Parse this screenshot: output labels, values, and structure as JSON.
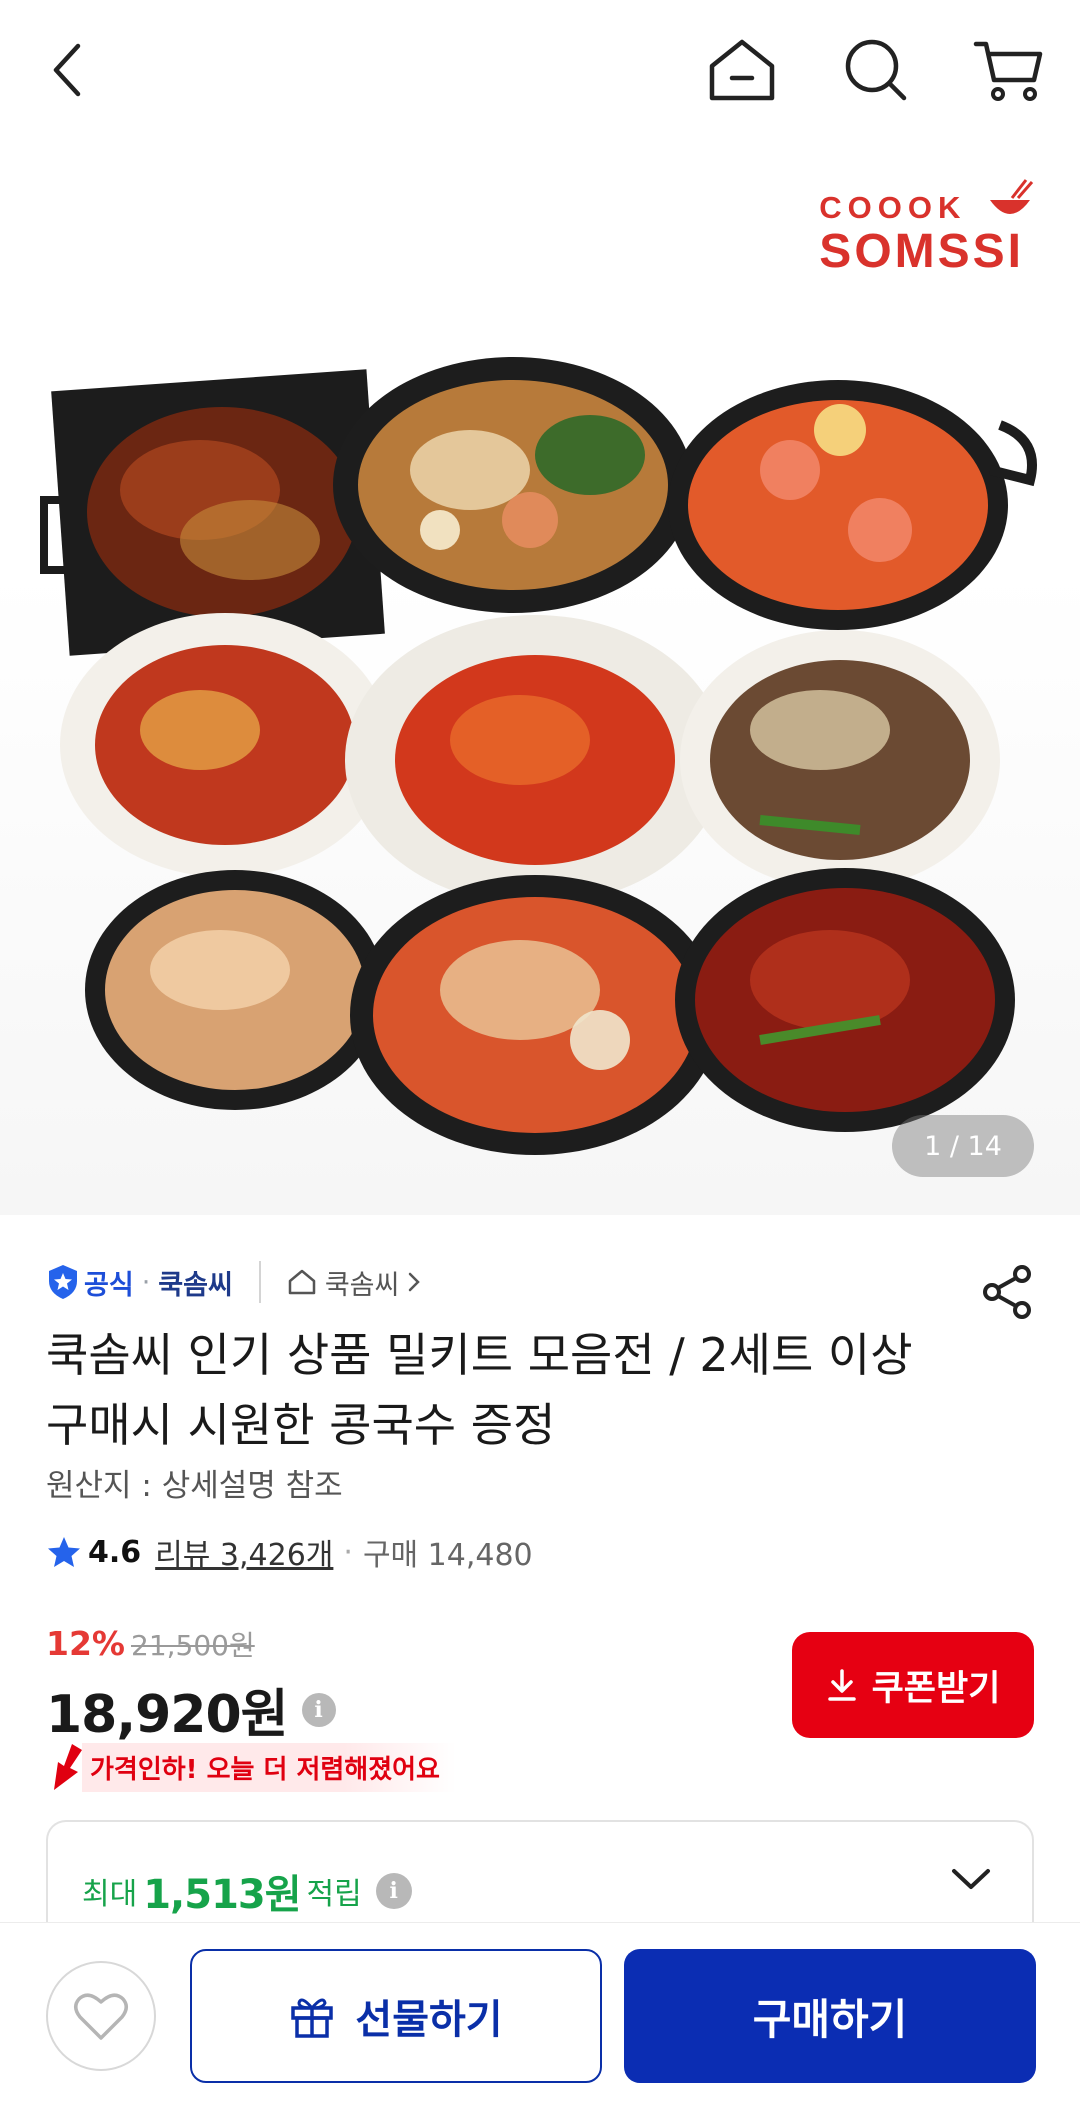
{
  "header": {
    "back_icon": "chevron-left-icon",
    "home_icon": "home-icon",
    "search_icon": "search-icon",
    "cart_icon": "cart-icon"
  },
  "hero": {
    "brand_line1": "COOOK",
    "brand_line2": "SOMSSI",
    "image_counter": "1 / 14"
  },
  "seller": {
    "official_label": "공식",
    "separator": "·",
    "name": "쿡솜씨",
    "store_link": "쿡솜씨"
  },
  "product": {
    "title": "쿡솜씨 인기 상품 밀키트 모음전 / 2세트 이상 구매시 시원한 콩국수 증정",
    "origin": "원산지 : 상세설명 참조"
  },
  "rating": {
    "score": "4.6",
    "reviews": "리뷰 3,426개",
    "separator": "·",
    "purchases": "구매 14,480"
  },
  "pricing": {
    "discount": "12%",
    "original_price": "21,500원",
    "price": "18,920원",
    "info_symbol": "i",
    "price_drop_notice": "가격인하! 오늘 더 저렴해졌어요",
    "coupon_label": "쿠폰받기"
  },
  "points": {
    "prefix": "최대",
    "amount": "1,513원",
    "suffix": "적립",
    "info_symbol": "i"
  },
  "bottom_bar": {
    "gift_label": "선물하기",
    "buy_label": "구매하기"
  },
  "colors": {
    "accent_blue": "#0b2db3",
    "coupon_red": "#e60012",
    "brand_red": "#d9322c",
    "points_green": "#16a34a"
  }
}
